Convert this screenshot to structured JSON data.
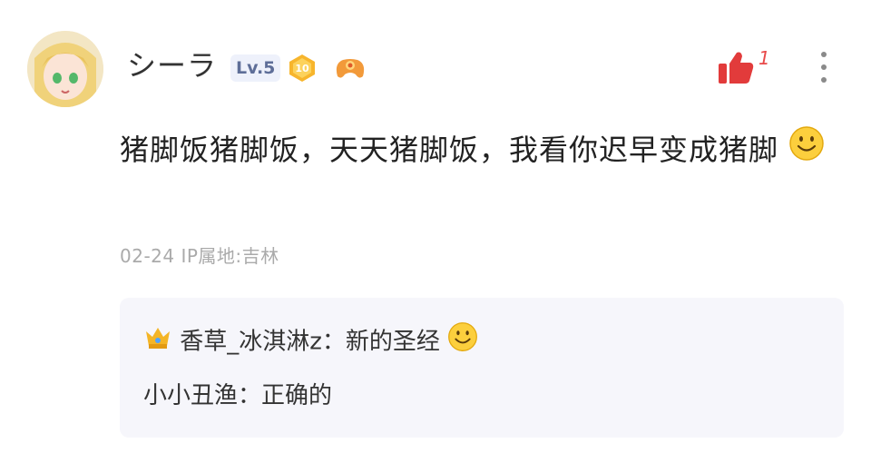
{
  "user": {
    "name": "シーラ",
    "level": "Lv.5",
    "badge_number": "10",
    "avatar_icon": "anime-avatar-icon"
  },
  "like": {
    "count": "1",
    "color": "#e23b3b"
  },
  "comment": {
    "text": "猪脚饭猪脚饭，天天猪脚饭，我看你迟早变成猪脚",
    "emoji": "smile-emoji"
  },
  "meta": {
    "text": "02-24 IP属地:吉林"
  },
  "replies": [
    {
      "author": "香草_冰淇淋z：",
      "text": "新的圣经",
      "icon": "crown-icon",
      "emoji": "smile-emoji"
    },
    {
      "author": "小小丑渔：",
      "text": "正确的"
    }
  ]
}
